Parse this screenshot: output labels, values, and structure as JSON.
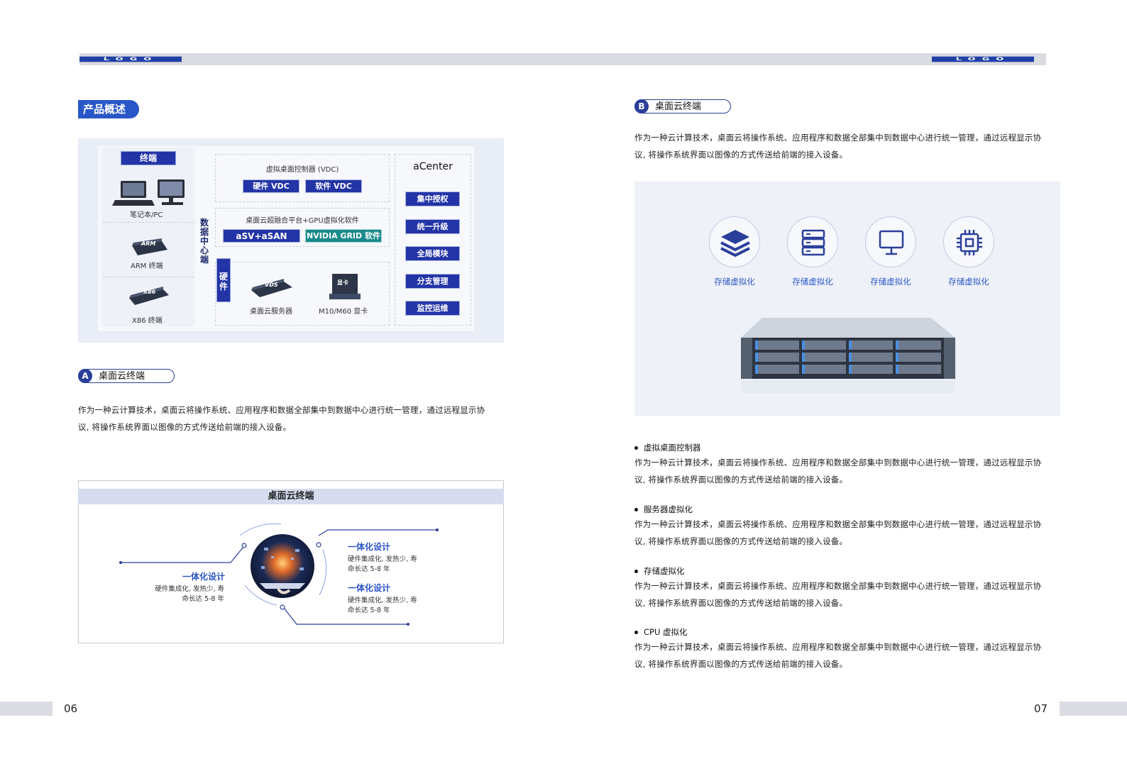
{
  "header": {
    "logo_left": "LOGO",
    "logo_right": "LOGO"
  },
  "left": {
    "section_title": "产品概述",
    "arch": {
      "terminal_label": "终端",
      "notebook_label": "笔记本/PC",
      "arm_label": "ARM 终端",
      "x86_label": "X86 终端",
      "arm_chip": "ARM",
      "x86_chip": "X86",
      "datacenter_label": "数据中心端",
      "vdc_title": "虚拟桌面控制器 (VDC)",
      "hw_vdc": "硬件 VDC",
      "sw_vdc": "软件 VDC",
      "platform_title": "桌面云超融合平台+GPU虚拟化软件",
      "asv": "aSV+aSAN",
      "nvidia": "NVIDIA GRID 软件",
      "hardware_label": "硬件",
      "server_label": "桌面云服务器",
      "server_chip": "VDS",
      "gpu_label": "M10/M60 显卡",
      "gpu_chip": "显卡",
      "acenter_title": "aCenter",
      "acenter_items": [
        "集中授权",
        "统一升级",
        "全局模块",
        "分支管理",
        "监控运维"
      ]
    },
    "sub_a": {
      "letter": "A",
      "title": "桌面云终端"
    },
    "para_a": [
      "作为一种云计算技术，桌面云将操作系统、应用程序和数据全部集中到数据中心进行统一管理，通过远程显示协",
      "议, 将操作系统界面以图像的方式传送给前端的接入设备。"
    ],
    "feature_box": {
      "title": "桌面云终端",
      "items": [
        {
          "title": "一体化设计",
          "desc": [
            "硬件集成化, 发热少, 寿",
            "命长达 5-8 年"
          ]
        },
        {
          "title": "一体化设计",
          "desc": [
            "硬件集成化, 发热少, 寿",
            "命长达 5-8 年"
          ]
        },
        {
          "title": "一体化设计",
          "desc": [
            "硬件集成化, 发热少, 寿",
            "命长达 5-8 年"
          ]
        }
      ]
    }
  },
  "right": {
    "sub_b": {
      "letter": "B",
      "title": "桌面云终端"
    },
    "para_b": [
      "作为一种云计算技术，桌面云将操作系统、应用程序和数据全部集中到数据中心进行统一管理，通过远程显示协",
      "议, 将操作系统界面以图像的方式传送给前端的接入设备。"
    ],
    "icons": [
      {
        "icon": "layers-icon",
        "caption": "存储虚拟化"
      },
      {
        "icon": "server-rack-icon",
        "caption": "存储虚拟化"
      },
      {
        "icon": "monitor-icon",
        "caption": "存储虚拟化"
      },
      {
        "icon": "cpu-chip-icon",
        "caption": "存储虚拟化"
      }
    ],
    "bullets": [
      {
        "title": "虚拟桌面控制器",
        "lines": [
          "作为一种云计算技术，桌面云将操作系统、应用程序和数据全部集中到数据中心进行统一管理，通过远程显示协",
          "议, 将操作系统界面以图像的方式传送给前端的接入设备。"
        ]
      },
      {
        "title": "服务器虚拟化",
        "lines": [
          "作为一种云计算技术，桌面云将操作系统、应用程序和数据全部集中到数据中心进行统一管理，通过远程显示协",
          "议, 将操作系统界面以图像的方式传送给前端的接入设备。"
        ]
      },
      {
        "title": "存储虚拟化",
        "lines": [
          "作为一种云计算技术，桌面云将操作系统、应用程序和数据全部集中到数据中心进行统一管理，通过远程显示协",
          "议, 将操作系统界面以图像的方式传送给前端的接入设备。"
        ]
      },
      {
        "title": "CPU 虚拟化",
        "lines": [
          "作为一种云计算技术，桌面云将操作系统、应用程序和数据全部集中到数据中心进行统一管理，通过远程显示协",
          "议, 将操作系统界面以图像的方式传送给前端的接入设备。"
        ]
      }
    ]
  },
  "footer": {
    "page_left": "06",
    "page_right": "07"
  },
  "colors": {
    "brand_blue": "#2a57c7",
    "navy": "#2334a6",
    "teal": "#1a8a8a",
    "bar_gray": "#dadce2"
  }
}
